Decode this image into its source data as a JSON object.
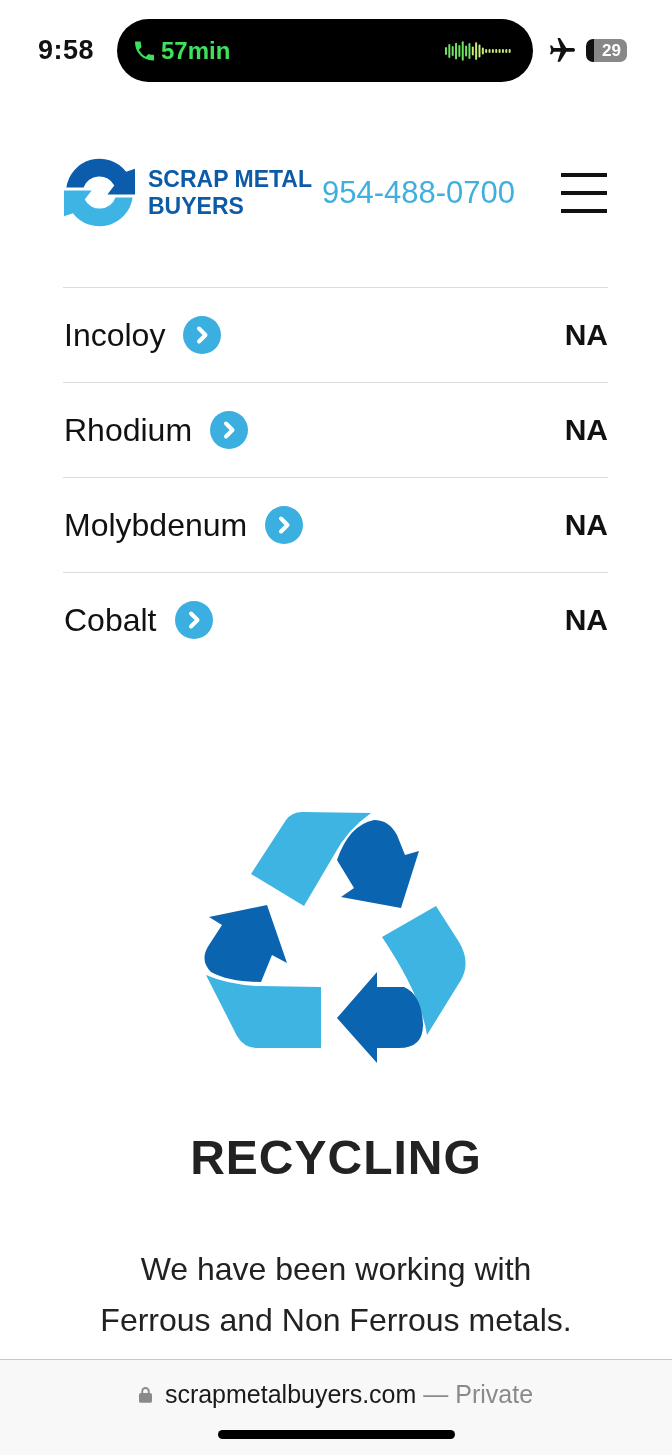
{
  "status_bar": {
    "time": "9:58",
    "call_duration": "57min",
    "battery": "29"
  },
  "header": {
    "logo_lines": [
      "SCRAP METAL",
      "BUYERS"
    ],
    "phone": "954-488-0700"
  },
  "prices": [
    {
      "name": "Incoloy",
      "price": "NA"
    },
    {
      "name": "Rhodium",
      "price": "NA"
    },
    {
      "name": "Molybdenum",
      "price": "NA"
    },
    {
      "name": "Cobalt",
      "price": "NA"
    }
  ],
  "feature": {
    "title": "RECYCLING",
    "text": "We have been working with Ferrous and Non Ferrous metals."
  },
  "browser_bar": {
    "url": "scrapmetalbuyers.com",
    "label": "— Private"
  }
}
